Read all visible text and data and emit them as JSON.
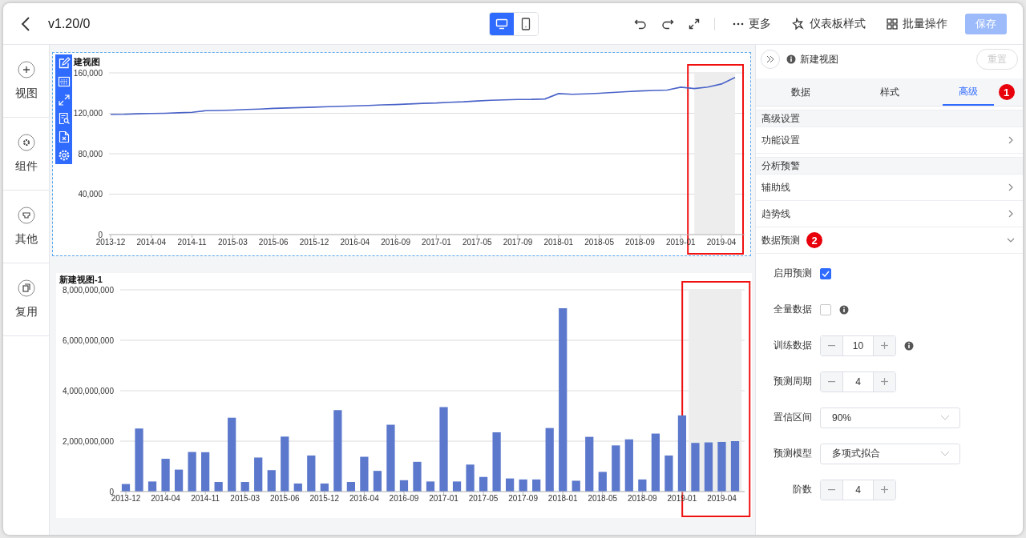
{
  "header": {
    "title": "v1.20/0",
    "device_modes": [
      {
        "kind": "desktop",
        "selected": true
      },
      {
        "kind": "mobile",
        "selected": false
      }
    ],
    "menus": [
      {
        "kind": "more",
        "label": "更多"
      },
      {
        "kind": "style",
        "label": "仪表板样式"
      },
      {
        "kind": "batch",
        "label": "批量操作"
      }
    ],
    "save_button": {
      "label": "保存",
      "disabled": true
    }
  },
  "sidebar": {
    "items": [
      {
        "kind": "view",
        "label": "视图"
      },
      {
        "kind": "component",
        "label": "组件"
      },
      {
        "kind": "other",
        "label": "其他"
      },
      {
        "kind": "reuse",
        "label": "复用"
      }
    ]
  },
  "charts": [
    {
      "selected": true,
      "highlight": true,
      "chart_data": {
        "type": "line",
        "title": "建视图",
        "categories": [
          "2013-12",
          null,
          null,
          "2014-04",
          null,
          null,
          "2014-11",
          null,
          null,
          "2015-03",
          null,
          null,
          "2015-06",
          null,
          null,
          "2015-12",
          null,
          null,
          "2016-04",
          null,
          null,
          "2016-09",
          null,
          null,
          "2017-01",
          null,
          null,
          "2017-05",
          null,
          null,
          "2017-09",
          null,
          null,
          "2018-01",
          null,
          null,
          "2018-05",
          null,
          null,
          "2018-09",
          null,
          null,
          "2019-01",
          null,
          null,
          "2019-04",
          null
        ],
        "series": [
          {
            "color": "#4a63c8",
            "values": [
              118800,
              119000,
              119500,
              119800,
              120000,
              120500,
              121000,
              122500,
              122800,
              123200,
              123800,
              124200,
              124800,
              125200,
              125600,
              126000,
              126500,
              127000,
              127300,
              127800,
              128300,
              128600,
              129200,
              129800,
              130200,
              130900,
              131400,
              132200,
              132900,
              133300,
              133700,
              133800,
              134200,
              139500,
              138800,
              139200,
              139800,
              140600,
              141400,
              142100,
              142600,
              143000,
              145800,
              144500,
              146000,
              149000,
              155500
            ]
          }
        ],
        "ylim": [
          0,
          160000
        ],
        "yticks": [
          {
            "value": 0,
            "label": "0"
          },
          {
            "value": 40000,
            "label": "40,000"
          },
          {
            "value": 80000,
            "label": "80,000"
          },
          {
            "value": 120000,
            "label": "120,000"
          },
          {
            "value": 160000,
            "label": "160,000"
          }
        ],
        "grid": true
      }
    },
    {
      "selected": false,
      "highlight": true,
      "chart_data": {
        "type": "bar",
        "title": "新建视图-1",
        "categories": [
          "2013-12",
          null,
          null,
          "2014-04",
          null,
          null,
          "2014-11",
          null,
          null,
          "2015-03",
          null,
          null,
          "2015-06",
          null,
          null,
          "2015-12",
          null,
          null,
          "2016-04",
          null,
          null,
          "2016-09",
          null,
          null,
          "2017-01",
          null,
          null,
          "2017-05",
          null,
          null,
          "2017-09",
          null,
          null,
          "2018-01",
          null,
          null,
          "2018-05",
          null,
          null,
          "2018-09",
          null,
          null,
          "2019-01",
          null,
          null,
          "2019-04",
          null
        ],
        "series": [
          {
            "color": "#5b78cc",
            "values": [
              300000000,
              2500000000,
              400000000,
              1300000000,
              870000000,
              1570000000,
              1560000000,
              380000000,
              2930000000,
              380000000,
              1350000000,
              850000000,
              2180000000,
              320000000,
              1430000000,
              320000000,
              3230000000,
              380000000,
              1380000000,
              820000000,
              2650000000,
              450000000,
              1180000000,
              400000000,
              3350000000,
              400000000,
              1070000000,
              580000000,
              2350000000,
              520000000,
              480000000,
              480000000,
              2520000000,
              7270000000,
              430000000,
              2170000000,
              780000000,
              1830000000,
              2070000000,
              480000000,
              2300000000,
              1430000000,
              3020000000,
              1930000000,
              1950000000,
              1970000000,
              2000000000
            ]
          }
        ],
        "ylim": [
          0,
          8000000000
        ],
        "yticks": [
          {
            "value": 0,
            "label": "0"
          },
          {
            "value": 2000000000,
            "label": "2,000,000,000"
          },
          {
            "value": 4000000000,
            "label": "4,000,000,000"
          },
          {
            "value": 6000000000,
            "label": "6,000,000,000"
          },
          {
            "value": 8000000000,
            "label": "8,000,000,000"
          }
        ],
        "grid": true
      }
    }
  ],
  "panel": {
    "title": "新建视图",
    "reset_button": {
      "label": "重置",
      "disabled": true
    },
    "tabs": [
      {
        "label": "数据",
        "selected": false
      },
      {
        "label": "样式",
        "selected": false
      },
      {
        "label": "高级",
        "selected": true,
        "marker": "1"
      }
    ],
    "sections": [
      {
        "heading": "高级设置",
        "items": [
          {
            "label": "功能设置",
            "expanded": false
          }
        ]
      },
      {
        "heading": "分析预警",
        "items": [
          {
            "label": "辅助线",
            "expanded": false
          },
          {
            "label": "趋势线",
            "expanded": false
          },
          {
            "label": "数据预测",
            "expanded": true,
            "marker": "2",
            "fields": [
              {
                "kind": "checkbox",
                "label": "启用预测",
                "checked": true
              },
              {
                "kind": "checkbox",
                "label": "全量数据",
                "checked": false,
                "info": true
              },
              {
                "kind": "stepper",
                "label": "训练数据",
                "value": "10",
                "info": true
              },
              {
                "kind": "stepper",
                "label": "预测周期",
                "value": "4"
              },
              {
                "kind": "select",
                "label": "置信区间",
                "value": "90%"
              },
              {
                "kind": "select",
                "label": "预测模型",
                "value": "多项式拟合"
              },
              {
                "kind": "stepper",
                "label": "阶数",
                "value": "4"
              }
            ]
          }
        ]
      }
    ]
  }
}
